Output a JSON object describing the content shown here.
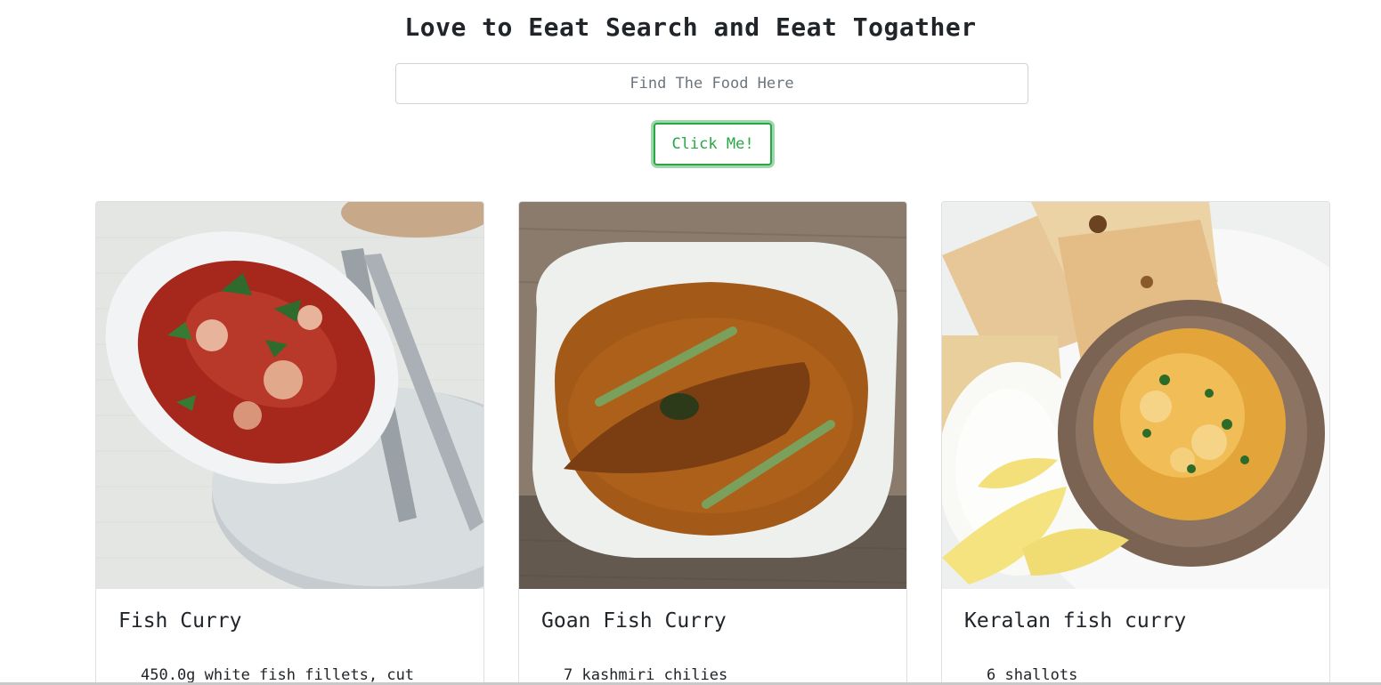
{
  "header": {
    "title": "Love to Eeat Search and Eeat Togather"
  },
  "search": {
    "placeholder": "Find The Food Here",
    "value": ""
  },
  "button": {
    "label": "Click Me!",
    "accent_color": "#28a745"
  },
  "cards": [
    {
      "title": "Fish Curry",
      "first_ingredient": "450.0g white fish fillets, cut",
      "image_icon": "fish-curry-photo"
    },
    {
      "title": "Goan Fish Curry",
      "first_ingredient": "7 kashmiri chilies",
      "image_icon": "goan-fish-curry-photo"
    },
    {
      "title": "Keralan fish curry",
      "first_ingredient": "6 shallots",
      "image_icon": "keralan-fish-curry-photo"
    }
  ]
}
